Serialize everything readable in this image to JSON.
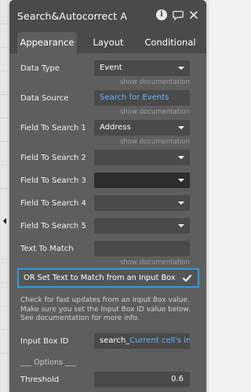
{
  "window": {
    "title": "Search&Autocorrect A"
  },
  "header_icons": [
    "info-icon",
    "comment-icon",
    "close-icon"
  ],
  "tabs": [
    {
      "label": "Appearance",
      "active": true
    },
    {
      "label": "Layout",
      "active": false
    },
    {
      "label": "Conditional",
      "active": false
    }
  ],
  "fields": {
    "data_type": {
      "label": "Data Type",
      "value": "Event",
      "doc": "show documentation"
    },
    "data_source": {
      "label": "Data Source",
      "value": "Search for Events",
      "doc": "show documentation"
    },
    "field1": {
      "label": "Field To Search 1",
      "value": "Address",
      "doc": "show documentation"
    },
    "field2": {
      "label": "Field To Search 2",
      "value": ""
    },
    "field3": {
      "label": "Field To Search 3",
      "value": ""
    },
    "field4": {
      "label": "Field To Search 4",
      "value": ""
    },
    "field5": {
      "label": "Field To Search 5",
      "value": ""
    },
    "text_to_match": {
      "label": "Text To Match",
      "value": "",
      "doc": "show documentation"
    }
  },
  "or_set": {
    "label": "OR Set Text to Match from an Input Box",
    "checked": true
  },
  "help_text": "Check for fast updates from an Input Box value. Make sure you set the Input Box ID value below. See documentation for more info.",
  "input_box_id": {
    "label": "Input Box ID",
    "prefix": "search_",
    "dynamic": "Current cell's index"
  },
  "options_header": "___ Options ___",
  "threshold": {
    "label": "Threshold",
    "value": "0.6"
  },
  "colors": {
    "panel": "#4a4a4a",
    "body": "#5e5e5e",
    "accent": "#2b9ed8",
    "link": "#66b3ff"
  }
}
